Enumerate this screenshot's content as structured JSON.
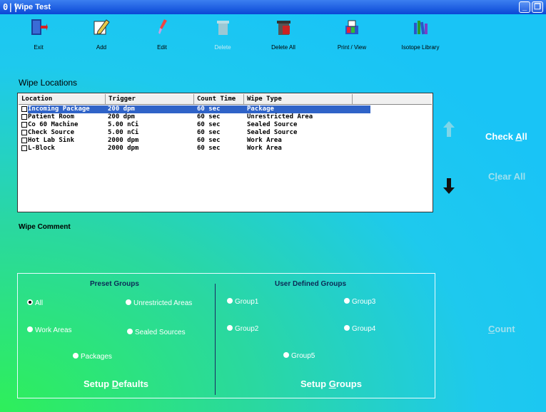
{
  "window": {
    "title": "Wipe Test",
    "app_icon_text": "0||"
  },
  "titlebar_buttons": {
    "minimize": "_",
    "restore": "❐"
  },
  "toolbar": [
    {
      "label": "Exit",
      "icon": "exit-door-icon",
      "enabled": true
    },
    {
      "label": "Add",
      "icon": "pencil-icon",
      "enabled": true
    },
    {
      "label": "Edit",
      "icon": "brush-icon",
      "enabled": true
    },
    {
      "label": "Delete",
      "icon": "trash-can-icon",
      "enabled": false
    },
    {
      "label": "Delete All",
      "icon": "trash-can-full-icon",
      "enabled": true
    },
    {
      "label": "Print / View",
      "icon": "printer-icon",
      "enabled": true
    },
    {
      "label": "Isotope Library",
      "icon": "library-books-icon",
      "enabled": true
    }
  ],
  "wipe_locations": {
    "label": "Wipe Locations",
    "columns": [
      "Location",
      "Trigger",
      "Count Time",
      "Wipe Type"
    ],
    "rows": [
      {
        "location": "Incoming Package",
        "trigger": "200 dpm",
        "count_time": "60 sec",
        "wipe_type": "Package",
        "selected": true
      },
      {
        "location": "Patient Room",
        "trigger": "200 dpm",
        "count_time": "60 sec",
        "wipe_type": "Unrestricted Area",
        "selected": false
      },
      {
        "location": "Co 60 Machine",
        "trigger": "5.00 nCi",
        "count_time": "60 sec",
        "wipe_type": "Sealed Source",
        "selected": false
      },
      {
        "location": "Check Source",
        "trigger": "5.00 nCi",
        "count_time": "60 sec",
        "wipe_type": "Sealed Source",
        "selected": false
      },
      {
        "location": "Hot Lab Sink",
        "trigger": "2000 dpm",
        "count_time": "60 sec",
        "wipe_type": "Work Area",
        "selected": false
      },
      {
        "location": "L-Block",
        "trigger": "2000 dpm",
        "count_time": "60 sec",
        "wipe_type": "Work Area",
        "selected": false
      }
    ]
  },
  "right_actions": {
    "check_all": {
      "pre": "Check ",
      "u": "A",
      "post": "ll"
    },
    "clear_all": {
      "pre": "C",
      "u": "l",
      "post": "ear All"
    },
    "count": {
      "pre": "",
      "u": "C",
      "post": "ount"
    }
  },
  "wipe_comment": {
    "label": "Wipe Comment"
  },
  "preset_groups": {
    "title": "Preset Groups",
    "options": [
      "All",
      "Unrestricted Areas",
      "Work Areas",
      "Sealed Sources",
      "Packages"
    ],
    "selected": "All",
    "setup_button": {
      "pre": "Setup ",
      "u": "D",
      "post": "efaults"
    }
  },
  "user_groups": {
    "title": "User Defined Groups",
    "options": [
      "Group1",
      "Group3",
      "Group2",
      "Group4",
      "Group5"
    ],
    "setup_button": {
      "pre": "Setup ",
      "u": "G",
      "post": "roups"
    }
  },
  "colors": {
    "selection": "#2f63c8",
    "titlebar": "#0a47d6",
    "disabled_text": "#c9ecf5"
  }
}
